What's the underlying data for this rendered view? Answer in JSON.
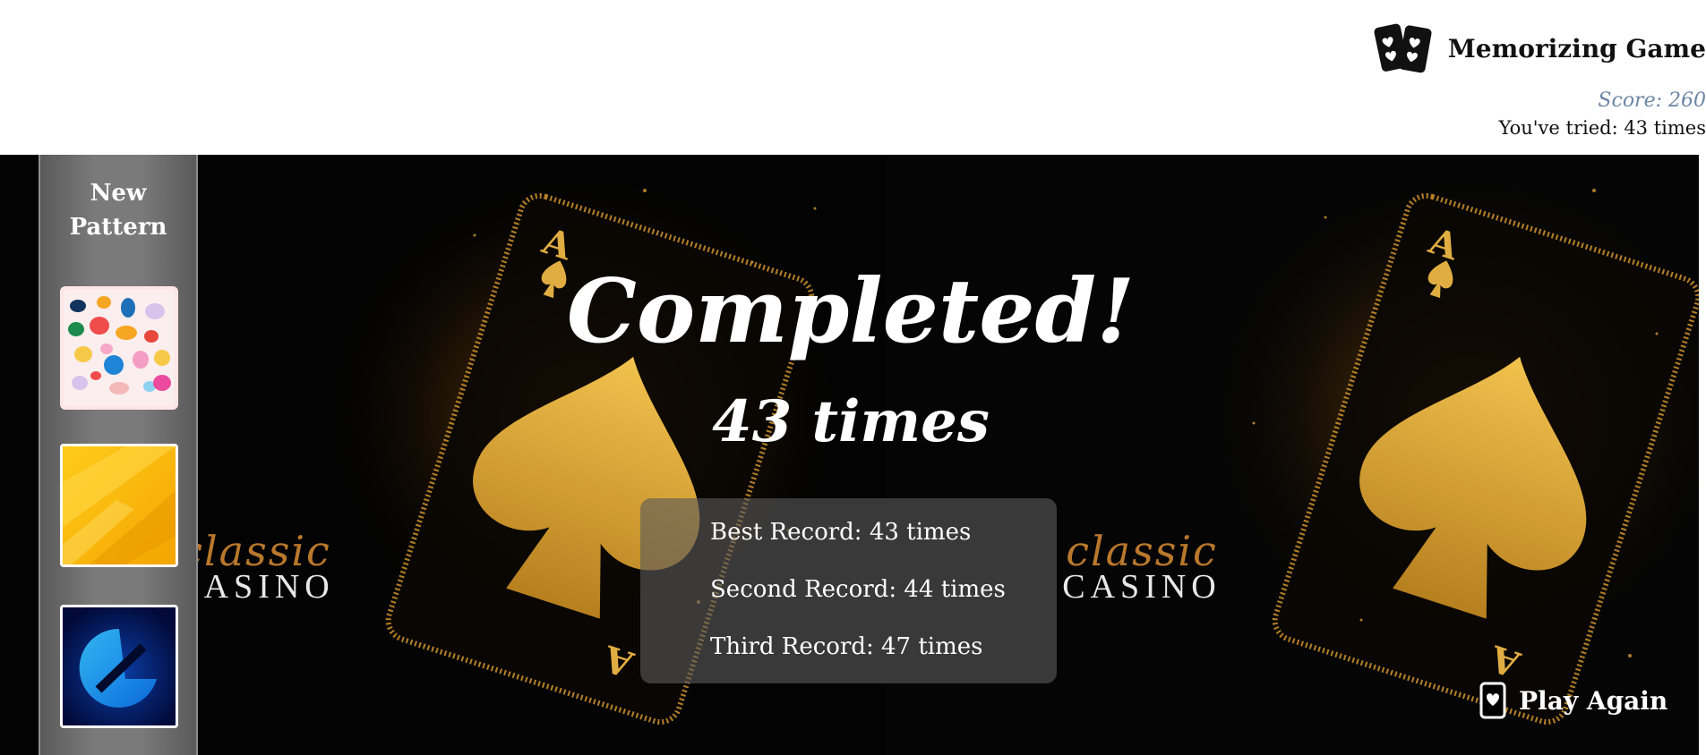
{
  "header": {
    "title": "Memorizing Game",
    "logo_icon": "playing-cards-icon",
    "score": "Score: 260",
    "tried": "You've tried: 43 times"
  },
  "sidebar": {
    "title": "New\nPattern",
    "patterns": [
      {
        "name": "pastel-blobs-pattern"
      },
      {
        "name": "yellow-gradient-pattern"
      },
      {
        "name": "blue-abstract-pattern"
      }
    ]
  },
  "background": {
    "watermark_script": "classic",
    "watermark_word": "CASINO"
  },
  "result": {
    "heading": "Completed!",
    "attempts": "43 times",
    "records": [
      "Best Record: 43 times",
      "Second Record: 44 times",
      "Third Record: 47 times"
    ]
  },
  "actions": {
    "play_again": "Play Again",
    "play_again_icon": "heart-card-icon"
  },
  "colors": {
    "score_text": "#6d86a6",
    "stage_background": "#030303",
    "gold_accent": "#d9a43a",
    "watermark_script": "#b9782c"
  }
}
